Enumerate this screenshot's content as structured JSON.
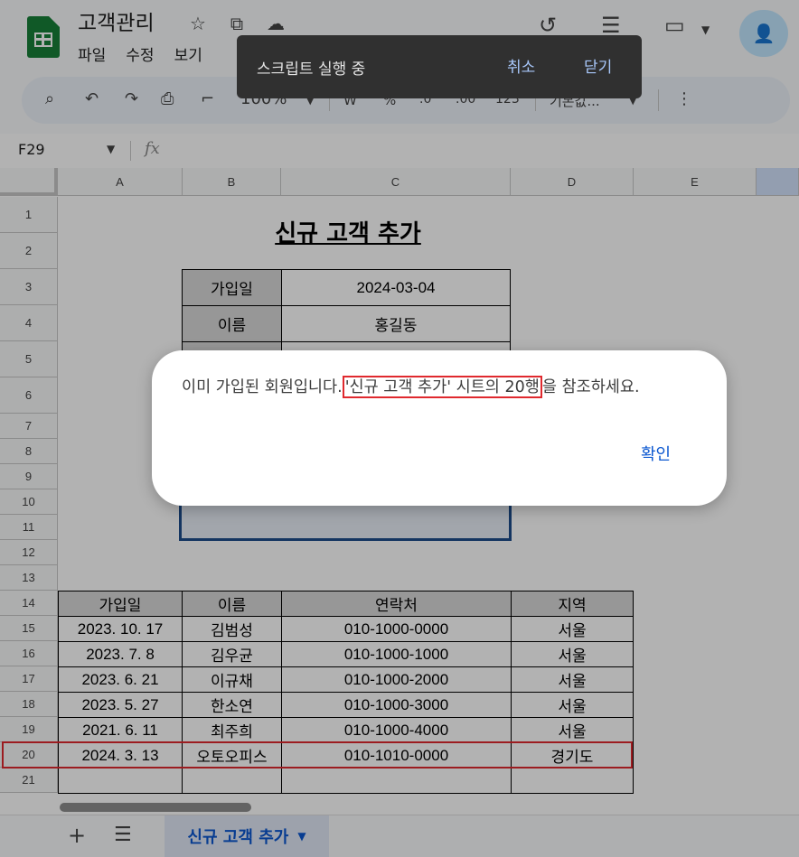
{
  "header": {
    "title": "고객관리",
    "menu": [
      "파일",
      "수정",
      "보기"
    ]
  },
  "toolbar": {
    "zoom": "100%",
    "currency": "W",
    "percent": "%",
    "decimal_decrease": ".0",
    "decimal_increase": ".00",
    "number_format": "123",
    "font": "기본값..."
  },
  "formula_bar": {
    "cell_ref": "F29",
    "fx": "fx"
  },
  "columns": [
    "A",
    "B",
    "C",
    "D",
    "E"
  ],
  "rows": [
    "1",
    "2",
    "3",
    "4",
    "5",
    "6",
    "7",
    "8",
    "9",
    "10",
    "11",
    "12",
    "13",
    "14",
    "15",
    "16",
    "17",
    "18",
    "19",
    "20",
    "21"
  ],
  "form": {
    "title": "신규 고객 추가",
    "join_date_label": "가입일",
    "join_date_value": "2024-03-04",
    "name_label": "이름",
    "name_value": "홍길동"
  },
  "table": {
    "headers": [
      "가입일",
      "이름",
      "연락처",
      "지역"
    ],
    "rows": [
      [
        "2023. 10. 17",
        "김범성",
        "010-1000-0000",
        "서울"
      ],
      [
        "2023. 7. 8",
        "김우균",
        "010-1000-1000",
        "서울"
      ],
      [
        "2023. 6. 21",
        "이규채",
        "010-1000-2000",
        "서울"
      ],
      [
        "2023. 5. 27",
        "한소연",
        "010-1000-3000",
        "서울"
      ],
      [
        "2021. 6. 11",
        "최주희",
        "010-1000-4000",
        "서울"
      ],
      [
        "2024. 3. 13",
        "오토오피스",
        "010-1010-0000",
        "경기도"
      ]
    ]
  },
  "sheet_tab": {
    "label": "신규 고객 추가"
  },
  "snackbar": {
    "text": "스크립트 실행 중",
    "cancel": "취소",
    "close": "닫기"
  },
  "dialog": {
    "message_before": "이미 가입된 회원입니다.",
    "message_highlight": "'신규 고객 추가' 시트의 20행",
    "message_after": "을 참조하세요.",
    "ok": "확인"
  },
  "colors": {
    "highlight_red": "#e0292e",
    "sheets_green": "#188038",
    "link_blue": "#0b57d0"
  }
}
